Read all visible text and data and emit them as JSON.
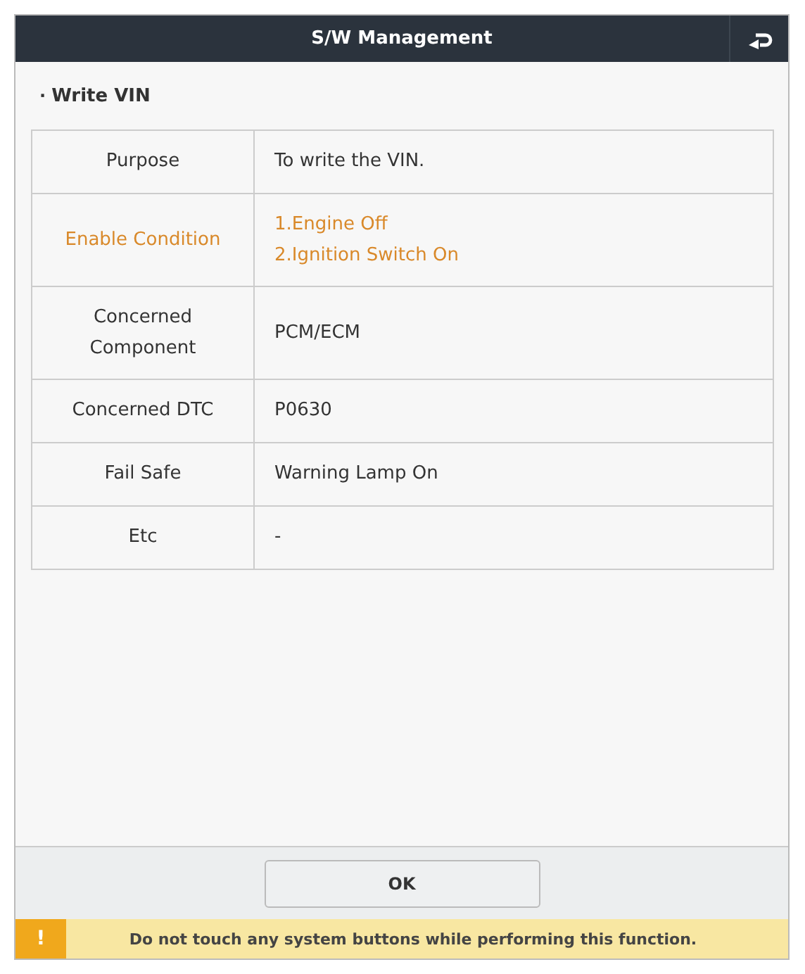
{
  "window": {
    "title": "S/W Management"
  },
  "section": {
    "bullet": "·",
    "title": "Write VIN"
  },
  "rows": [
    {
      "label": "Purpose",
      "lines": [
        "To write the VIN."
      ],
      "highlighted": false
    },
    {
      "label": "Enable Condition",
      "lines": [
        "1.Engine Off",
        "2.Ignition Switch On"
      ],
      "highlighted": true
    },
    {
      "label": "Concerned Component",
      "lines": [
        "PCM/ECM"
      ],
      "highlighted": false
    },
    {
      "label": "Concerned DTC",
      "lines": [
        "P0630"
      ],
      "highlighted": false
    },
    {
      "label": "Fail Safe",
      "lines": [
        "Warning Lamp On"
      ],
      "highlighted": false
    },
    {
      "label": "Etc",
      "lines": [
        "-"
      ],
      "highlighted": false
    }
  ],
  "buttons": [
    "OK"
  ],
  "warning": {
    "icon": "!",
    "text": "Do not touch any system buttons while performing this function."
  }
}
